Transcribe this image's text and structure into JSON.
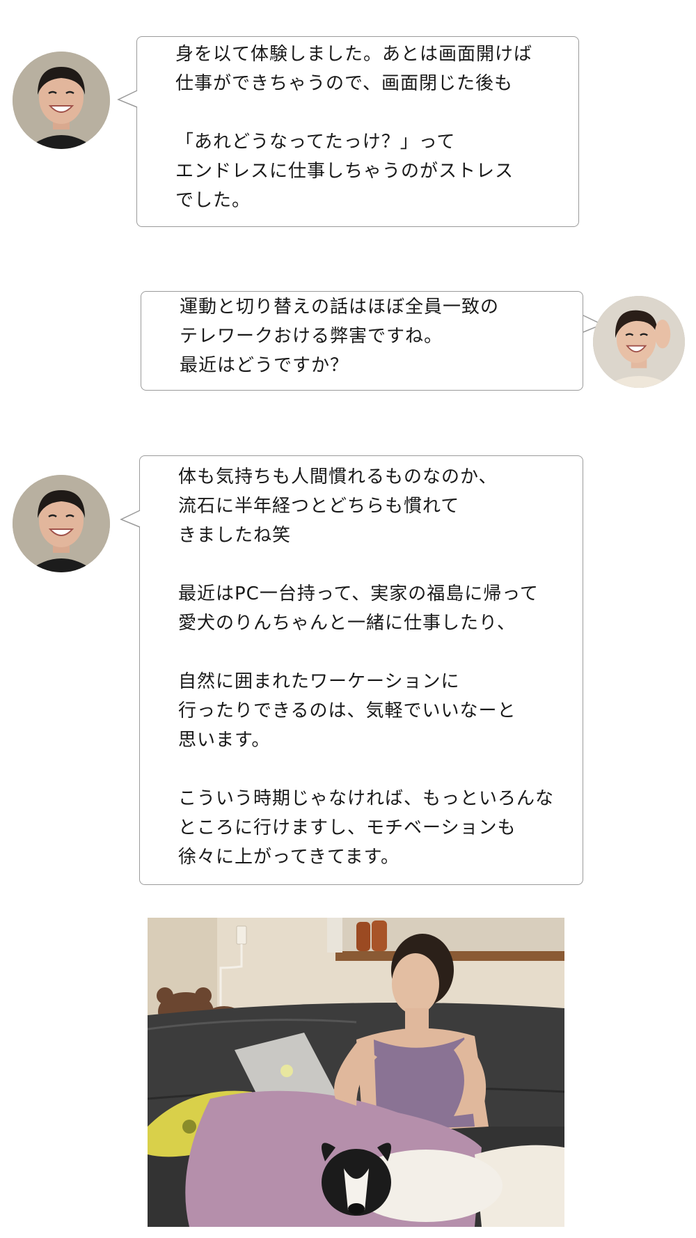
{
  "conversation": {
    "messages": [
      {
        "speaker": "interviewee",
        "avatar_icon": "smiling-woman-short-hair-avatar",
        "lines": [
          "身を以て体験しました。あとは画面開けば",
          "仕事ができちゃうので、画面閉じた後も",
          "",
          "「あれどうなってたっけ？」って",
          "エンドレスに仕事しちゃうのがストレス",
          "でした。"
        ]
      },
      {
        "speaker": "interviewer",
        "avatar_icon": "laughing-woman-avatar",
        "lines": [
          "運動と切り替えの話はほぼ全員一致の",
          "テレワークおける弊害ですね。",
          "最近はどうですか？"
        ]
      },
      {
        "speaker": "interviewee",
        "avatar_icon": "smiling-woman-short-hair-avatar",
        "lines": [
          "体も気持ちも人間慣れるものなのか、",
          "流石に半年経つとどちらも慣れて",
          "きましたね笑",
          "",
          "最近はPC一台持って、実家の福島に帰って",
          "愛犬のりんちゃんと一緒に仕事したり、",
          "",
          "自然に囲まれたワーケーションに",
          "行ったりできるのは、気軽でいいなーと",
          "思います。",
          "",
          "こういう時期じゃなければ、もっといろんな",
          "ところに行けますし、モチベーションも",
          "徐々に上がってきてます。"
        ]
      }
    ]
  },
  "photo": {
    "icon": "woman-working-on-laptop-on-sofa-with-dog-photo"
  },
  "colors": {
    "bubble_border": "#9a9a9a",
    "text": "#1a1a1a",
    "background": "#ffffff"
  }
}
